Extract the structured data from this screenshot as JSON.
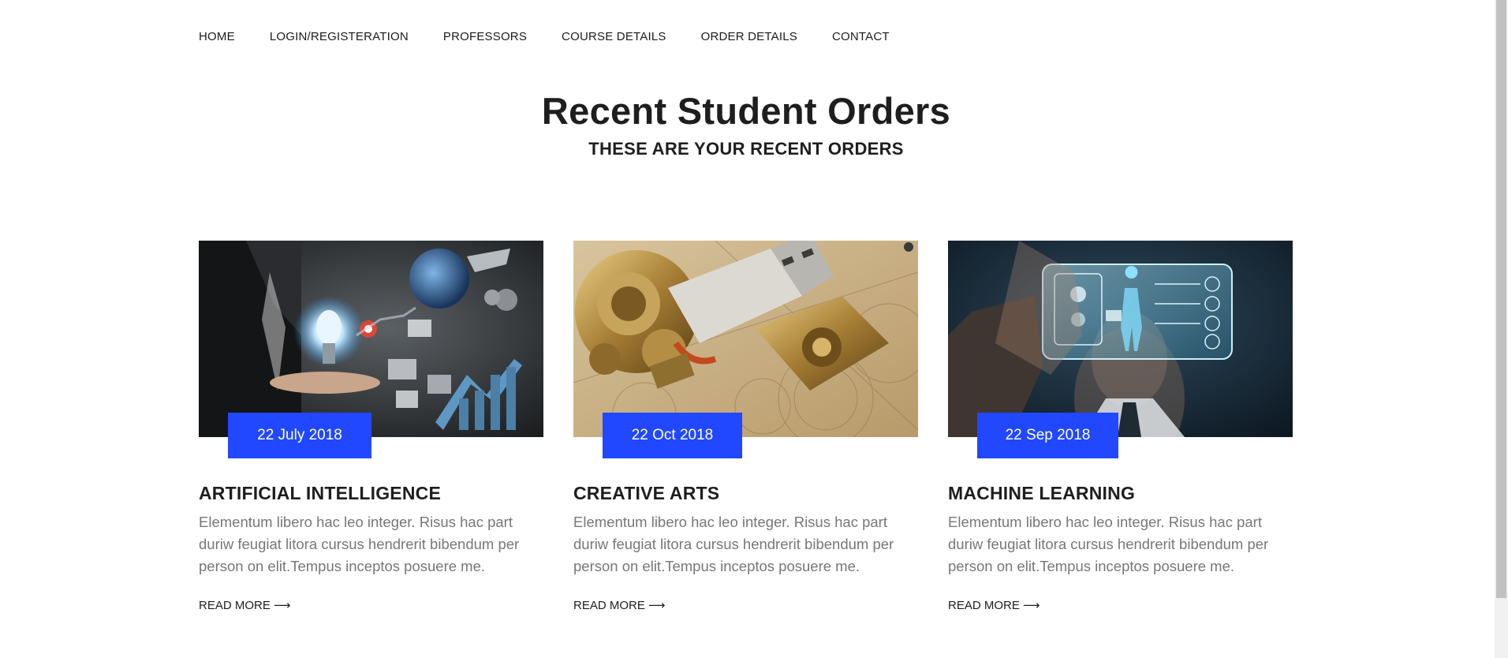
{
  "nav": {
    "items": [
      {
        "label": "HOME"
      },
      {
        "label": "LOGIN/REGISTERATION"
      },
      {
        "label": "PROFESSORS"
      },
      {
        "label": "COURSE DETAILS"
      },
      {
        "label": "ORDER DETAILS"
      },
      {
        "label": "CONTACT"
      }
    ]
  },
  "heading": {
    "title": "Recent Student Orders",
    "subtitle": "THESE ARE YOUR RECENT ORDERS"
  },
  "cards": [
    {
      "date": "22 July 2018",
      "title": "ARTIFICIAL INTELLIGENCE",
      "text": "Elementum libero hac leo integer. Risus hac part duriw feugiat litora cursus hendrerit bibendum per person on elit.Tempus inceptos posuere me.",
      "read_more": "READ MORE",
      "image": "business-technology-photo"
    },
    {
      "date": "22 Oct 2018",
      "title": "CREATIVE ARTS",
      "text": "Elementum libero hac leo integer. Risus hac part duriw feugiat litora cursus hendrerit bibendum per person on elit.Tempus inceptos posuere me.",
      "read_more": "READ MORE",
      "image": "steampunk-usb-photo"
    },
    {
      "date": "22 Sep 2018",
      "title": "MACHINE LEARNING",
      "text": "Elementum libero hac leo integer. Risus hac part duriw feugiat litora cursus hendrerit bibendum per person on elit.Tempus inceptos posuere me.",
      "read_more": "READ MORE",
      "image": "medical-hologram-photo"
    }
  ],
  "colors": {
    "accent": "#2148ff",
    "heading": "#1e1e1e",
    "body_text": "#777777"
  },
  "icons": {
    "read_more_arrow": "arrow-right-icon"
  }
}
